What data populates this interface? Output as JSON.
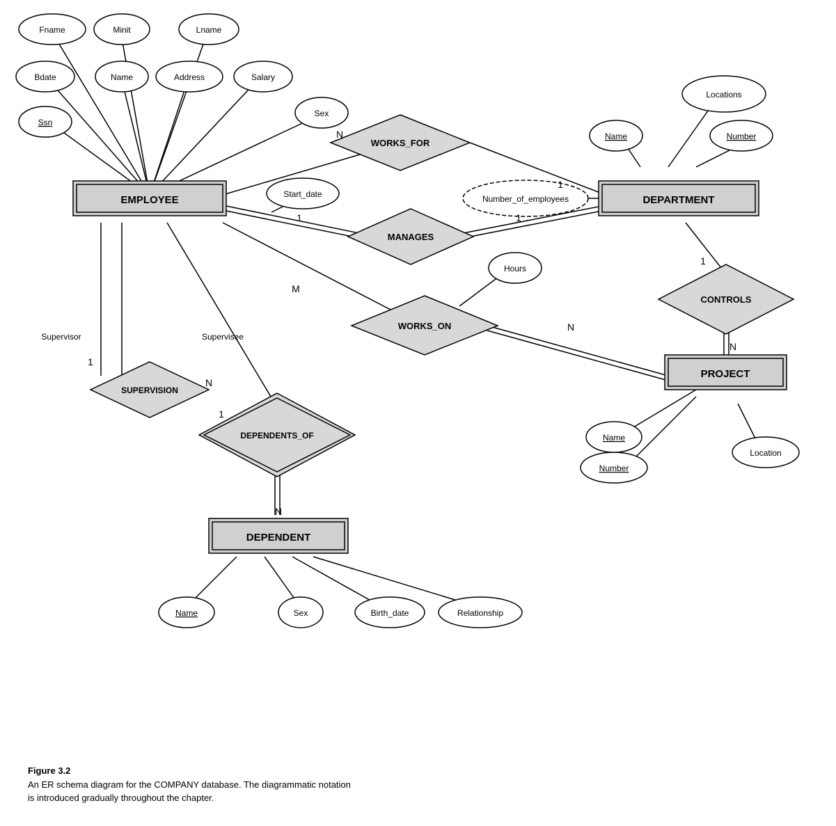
{
  "caption": {
    "title": "Figure 3.2",
    "line1": "An ER schema diagram for the COMPANY database. The diagrammatic notation",
    "line2": "is introduced gradually throughout the chapter."
  },
  "entities": {
    "employee": "EMPLOYEE",
    "department": "DEPARTMENT",
    "project": "PROJECT",
    "dependent": "DEPENDENT"
  },
  "relationships": {
    "works_for": "WORKS_FOR",
    "manages": "MANAGES",
    "works_on": "WORKS_ON",
    "supervision": "SUPERVISION",
    "dependents_of": "DEPENDENTS_OF",
    "controls": "CONTROLS"
  },
  "attributes": {
    "fname": "Fname",
    "minit": "Minit",
    "lname": "Lname",
    "bdate": "Bdate",
    "name_emp": "Name",
    "address": "Address",
    "salary": "Salary",
    "ssn": "Ssn",
    "sex_emp": "Sex",
    "start_date": "Start_date",
    "num_employees": "Number_of_employees",
    "locations": "Locations",
    "dept_name": "Name",
    "dept_number": "Number",
    "hours": "Hours",
    "proj_name": "Name",
    "proj_number": "Number",
    "proj_location": "Location",
    "dep_name": "Name",
    "dep_sex": "Sex",
    "birth_date": "Birth_date",
    "relationship": "Relationship"
  },
  "cardinalities": {
    "n1": "N",
    "n2": "1",
    "n3": "1",
    "n4": "1",
    "n5": "M",
    "n6": "N",
    "n7": "1",
    "n8": "N",
    "n9": "1",
    "n10": "N",
    "n11": "N",
    "n12": "1"
  }
}
